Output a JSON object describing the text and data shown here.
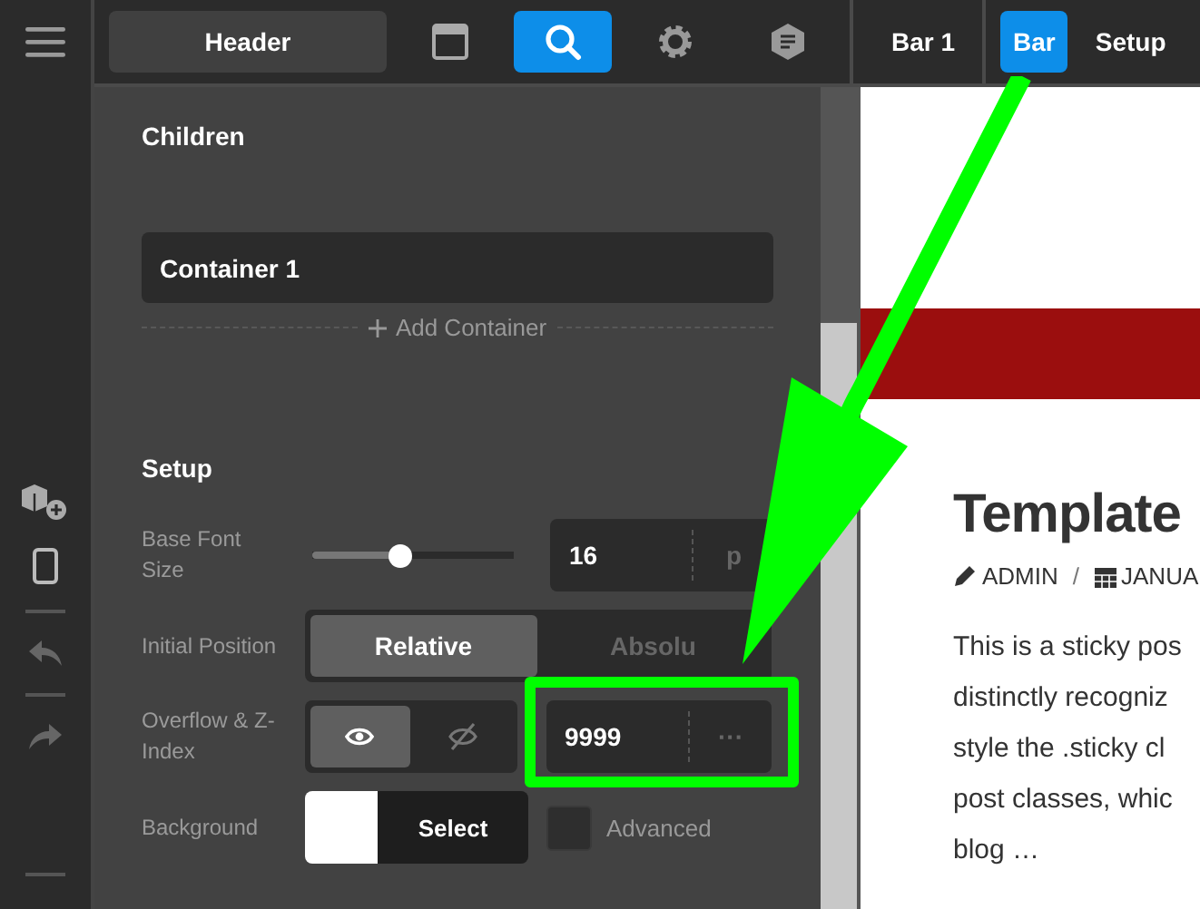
{
  "top_bar": {
    "header_button": "Header",
    "tools": [
      {
        "kind": "layout",
        "selected": false
      },
      {
        "kind": "search",
        "selected": true
      },
      {
        "kind": "settings",
        "selected": false
      },
      {
        "kind": "note",
        "selected": false
      }
    ],
    "breadcrumbs": [
      {
        "label": "Bar 1",
        "selected": false
      },
      {
        "label": "Bar",
        "selected": true
      },
      {
        "label": "Setup",
        "selected": false
      }
    ]
  },
  "panel": {
    "children_title": "Children",
    "containers": [
      {
        "label": "Container 1"
      }
    ],
    "add_container": "Add Container",
    "setup_title": "Setup",
    "font_size": {
      "label": "Base Font Size",
      "level": 0.43,
      "value": "16",
      "unit": "p"
    },
    "position": {
      "label": "Initial Position",
      "options": [
        {
          "label": "Relative",
          "selected": true
        },
        {
          "label": "Absolu",
          "selected": false
        }
      ]
    },
    "overflow": {
      "label": "Overflow & Z-Index",
      "options": [
        {
          "kind": "visible",
          "selected": true
        },
        {
          "kind": "hidden",
          "selected": false
        }
      ],
      "z_index": "9999",
      "more": "···"
    },
    "background": {
      "label": "Background",
      "button": "Select",
      "advanced": {
        "label": "Advanced",
        "checked": false
      }
    }
  },
  "preview": {
    "title": "Template",
    "author": "ADMIN",
    "separator": "/",
    "date": "JANUA",
    "body": "This is a sticky pos\ndistinctly recogniz\nstyle the .sticky cl\npost classes, whic\nblog …"
  }
}
